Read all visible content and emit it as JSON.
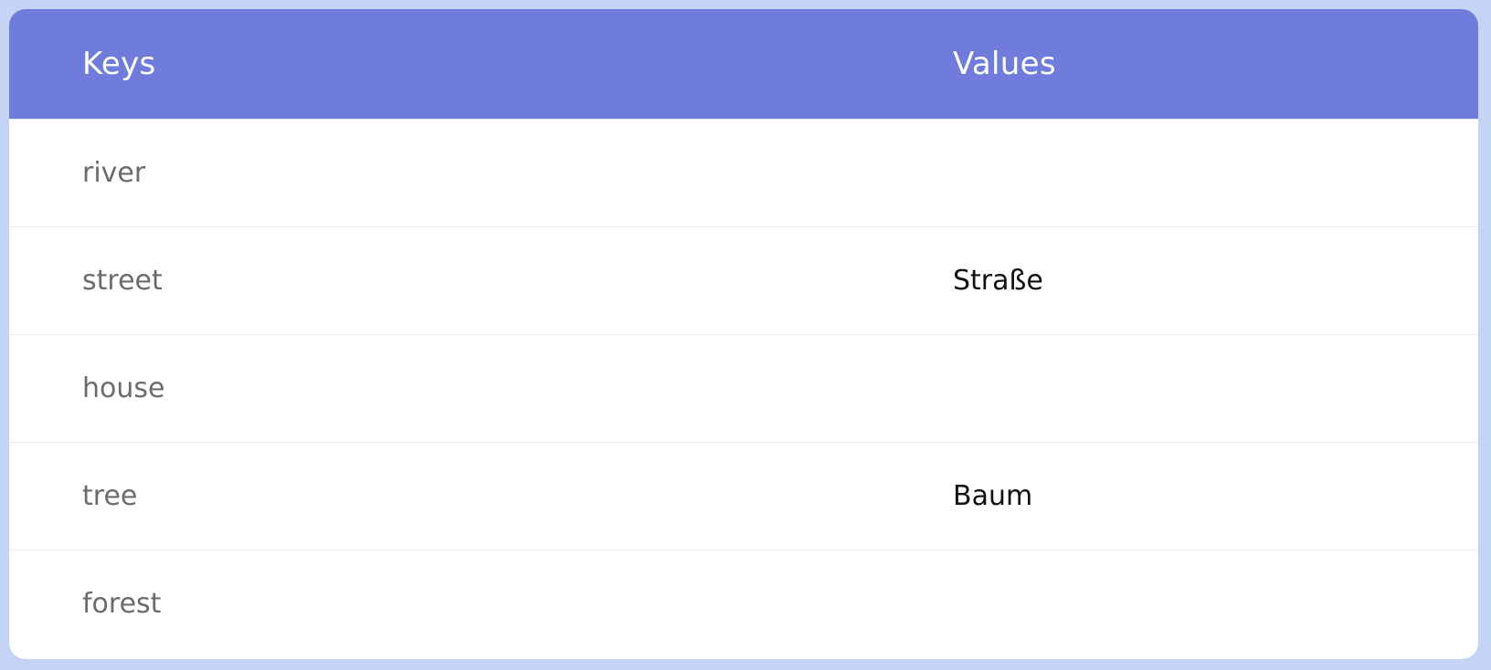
{
  "colors": {
    "page_background": "#c5d4f4",
    "header_background": "#6f7cdb",
    "card_background": "#ffffff",
    "key_text": "#6b6b6b",
    "value_text": "#111111"
  },
  "table": {
    "headers": {
      "keys": "Keys",
      "values": "Values"
    },
    "rows": [
      {
        "key": "river",
        "value": ""
      },
      {
        "key": "street",
        "value": "Straße"
      },
      {
        "key": "house",
        "value": ""
      },
      {
        "key": "tree",
        "value": "Baum"
      },
      {
        "key": "forest",
        "value": ""
      }
    ]
  }
}
